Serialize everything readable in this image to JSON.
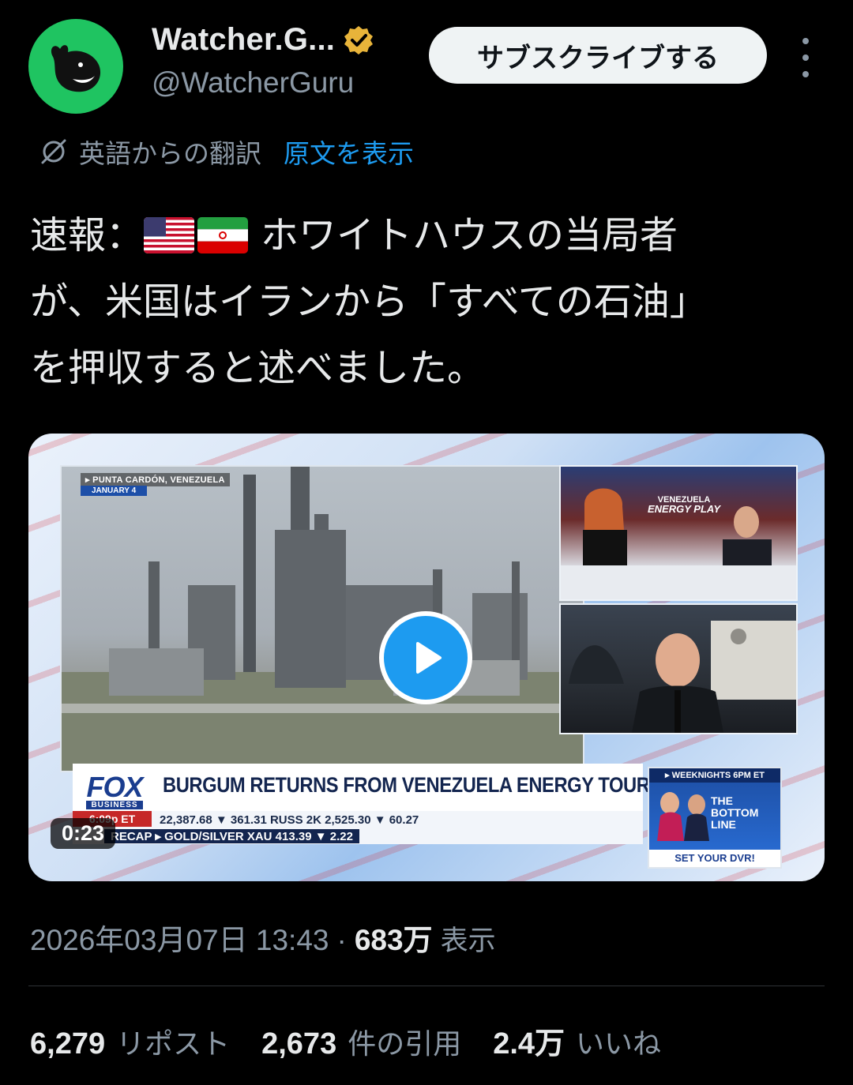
{
  "author": {
    "display_name": "Watcher.G...",
    "handle": "@WatcherGuru",
    "avatar_color": "#1fc461",
    "verified_badge_color": "#e8b43a"
  },
  "header": {
    "subscribe_label": "サブスクライブする"
  },
  "translation": {
    "label": "英語からの翻訳",
    "show_original_label": "原文を表示"
  },
  "tweet": {
    "line1_prefix": "速報：",
    "line1_suffix": "ホワイトハウスの当局者",
    "line2": "が、米国はイランから「すべての石油」",
    "line3": "を押収すると述べました。"
  },
  "media": {
    "duration": "0:23",
    "location_tag": "▸ PUNTA CARDÓN, VENEZUELA",
    "location_date": "JANUARY 4",
    "segment_tag_top": "VENEZUELA",
    "segment_tag_title": "ENERGY PLAY",
    "network_logo": "FOX",
    "network_sub": "BUSINESS",
    "headline": "BURGUM RETURNS FROM VENEZUELA ENERGY TOUR",
    "ticker_time": "6:09p ET",
    "ticker_line1": "22,387.68 ▼ 361.31   RUSS 2K   2,525.30 ▼ 60.27",
    "ticker_line2": "RECAP ▸ GOLD/SILVER  XAU  413.39 ▼ 2.22",
    "promo_top": "▸ WEEKNIGHTS 6PM ET",
    "promo_show": "THE BOTTOM LINE",
    "promo_bottom": "SET YOUR DVR!"
  },
  "meta": {
    "timestamp": "2026年03月07日 13:43",
    "separator": "·",
    "views_count": "683万",
    "views_label": "表示"
  },
  "stats": {
    "reposts_count": "6,279",
    "reposts_label": "リポスト",
    "quotes_count": "2,673",
    "quotes_label": "件の引用",
    "likes_count": "2.4万",
    "likes_label": "いいね"
  },
  "colors": {
    "background": "#000000",
    "text_primary": "#e7e9ea",
    "text_secondary": "#8b98a5",
    "link": "#1d9bf0"
  }
}
